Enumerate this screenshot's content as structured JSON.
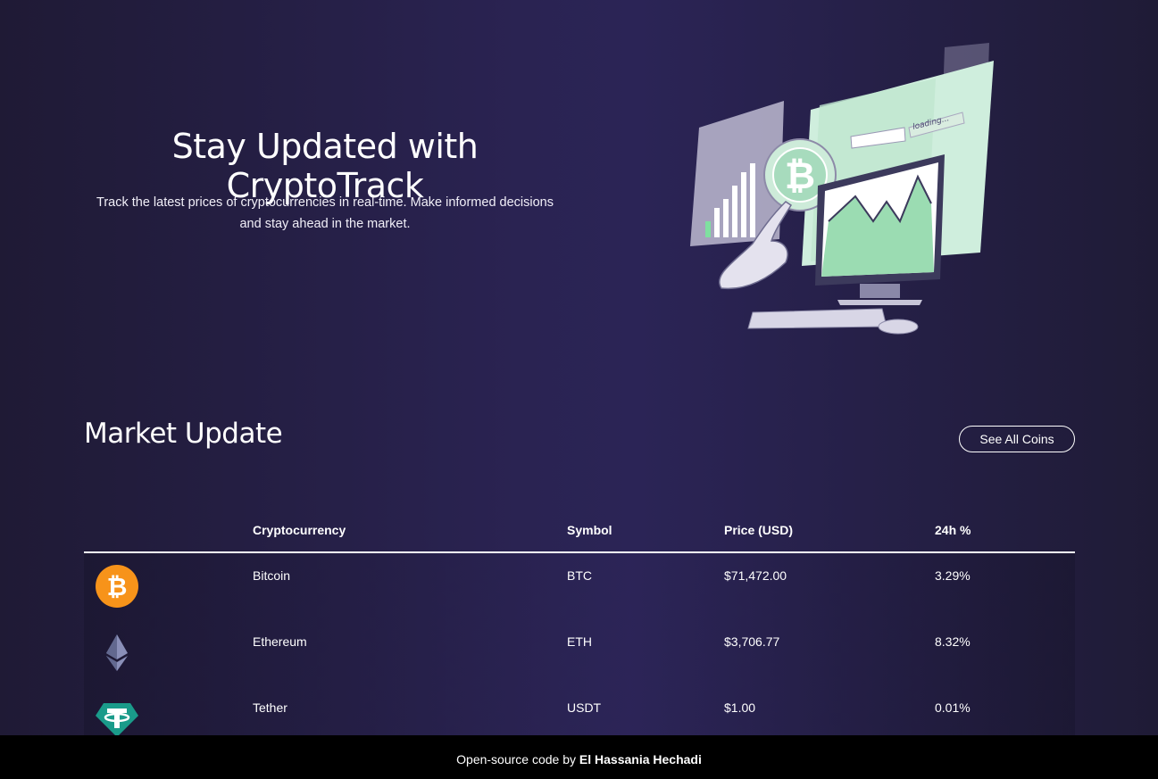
{
  "hero": {
    "title": "Stay Updated with CryptoTrack",
    "subtitle": "Track the latest prices of cryptocurrencies in real-time. Make informed decisions and stay ahead in the market.",
    "illustration_text": "loading..."
  },
  "market": {
    "title": "Market Update",
    "see_all_label": "See All Coins",
    "columns": [
      "Cryptocurrency",
      "Symbol",
      "Price (USD)",
      "24h %"
    ],
    "rows": [
      {
        "icon": "bitcoin-icon",
        "name": "Bitcoin",
        "symbol": "BTC",
        "price": "$71,472.00",
        "change": "3.29%"
      },
      {
        "icon": "ethereum-icon",
        "name": "Ethereum",
        "symbol": "ETH",
        "price": "$3,706.77",
        "change": "8.32%"
      },
      {
        "icon": "tether-icon",
        "name": "Tether",
        "symbol": "USDT",
        "price": "$1.00",
        "change": "0.01%"
      }
    ]
  },
  "footer": {
    "prefix": "Open-source code by ",
    "author": "El Hassania Hechadi"
  },
  "colors": {
    "background": "#2a2352",
    "bitcoin": "#f7931a",
    "ethereum": "#62688f",
    "tether": "#1a9b8a",
    "footer": "#000000"
  }
}
